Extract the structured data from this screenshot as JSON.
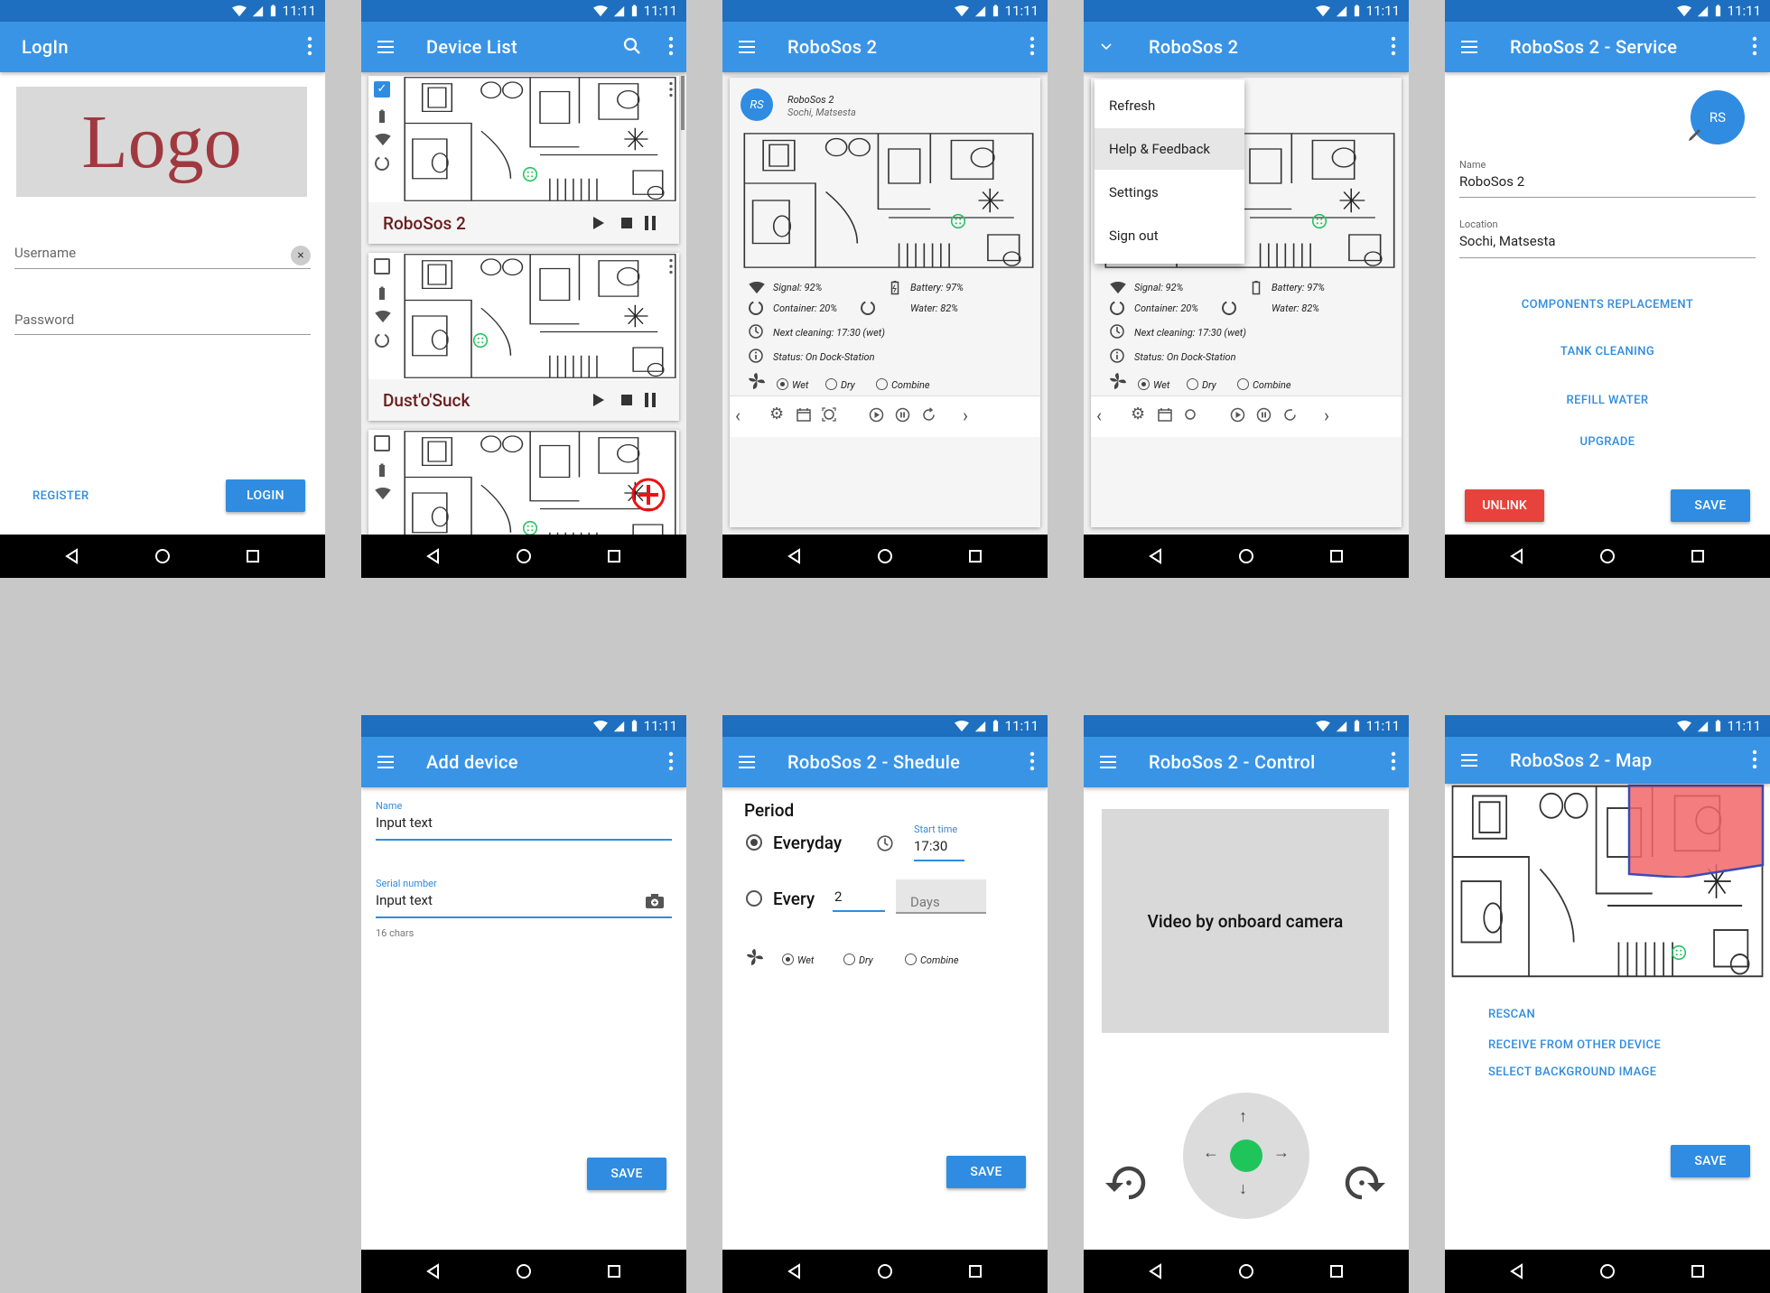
{
  "status": {
    "time": "11:11"
  },
  "login": {
    "title": "LogIn",
    "logo": "Logo",
    "username_placeholder": "Username",
    "password_placeholder": "Password",
    "register": "REGISTER",
    "login": "LOGIN"
  },
  "device_list": {
    "title": "Device List",
    "devices": [
      {
        "name": "RoboSos 2",
        "checked": true
      },
      {
        "name": "Dust'o'Suck",
        "checked": false
      }
    ]
  },
  "device": {
    "title": "RoboSos 2",
    "avatar": "RS",
    "name": "RoboSos 2",
    "location": "Sochi, Matsesta",
    "signal": "Signal: 92%",
    "battery": "Battery: 97%",
    "container": "Container: 20%",
    "water": "Water: 82%",
    "next_cleaning": "Next cleaning: 17:30 (wet)",
    "status": "Status: On Dock-Station",
    "mode_wet": "Wet",
    "mode_dry": "Dry",
    "mode_combine": "Combine"
  },
  "menu": {
    "items": [
      "Refresh",
      "Help & Feedback",
      "Settings",
      "Sign out"
    ]
  },
  "service": {
    "title": "RoboSos 2 - Service",
    "avatar": "RS",
    "name_label": "Name",
    "name_value": "RoboSos 2",
    "location_label": "Location",
    "location_value": "Sochi, Matsesta",
    "actions": [
      "COMPONENTS REPLACEMENT",
      "TANK CLEANING",
      "REFILL WATER",
      "UPGRADE"
    ],
    "unlink": "UNLINK",
    "save": "SAVE"
  },
  "add_device": {
    "title": "Add device",
    "name_label": "Name",
    "name_value": "Input text",
    "serial_label": "Serial number",
    "serial_value": "Input text",
    "helper": "16 chars",
    "save": "SAVE"
  },
  "schedule": {
    "title": "RoboSos 2 - Shedule",
    "period": "Period",
    "everyday": "Everyday",
    "start_time_label": "Start time",
    "start_time": "17:30",
    "every": "Every",
    "every_value": "2",
    "days_placeholder": "Days",
    "mode_wet": "Wet",
    "mode_dry": "Dry",
    "mode_combine": "Combine",
    "save": "SAVE"
  },
  "control": {
    "title": "RoboSos 2 - Control",
    "video": "Video by onboard camera"
  },
  "map": {
    "title": "RoboSos 2 - Map",
    "actions": [
      "RESCAN",
      "RECEIVE FROM OTHER DEVICE",
      "SELECT BACKGROUND IMAGE"
    ],
    "save": "SAVE"
  },
  "colors": {
    "primary": "#3a94e6",
    "status_bar": "#1e6fbf",
    "danger": "#e8423d",
    "accent_green": "#22c55e",
    "brand_red": "#a0393f"
  }
}
